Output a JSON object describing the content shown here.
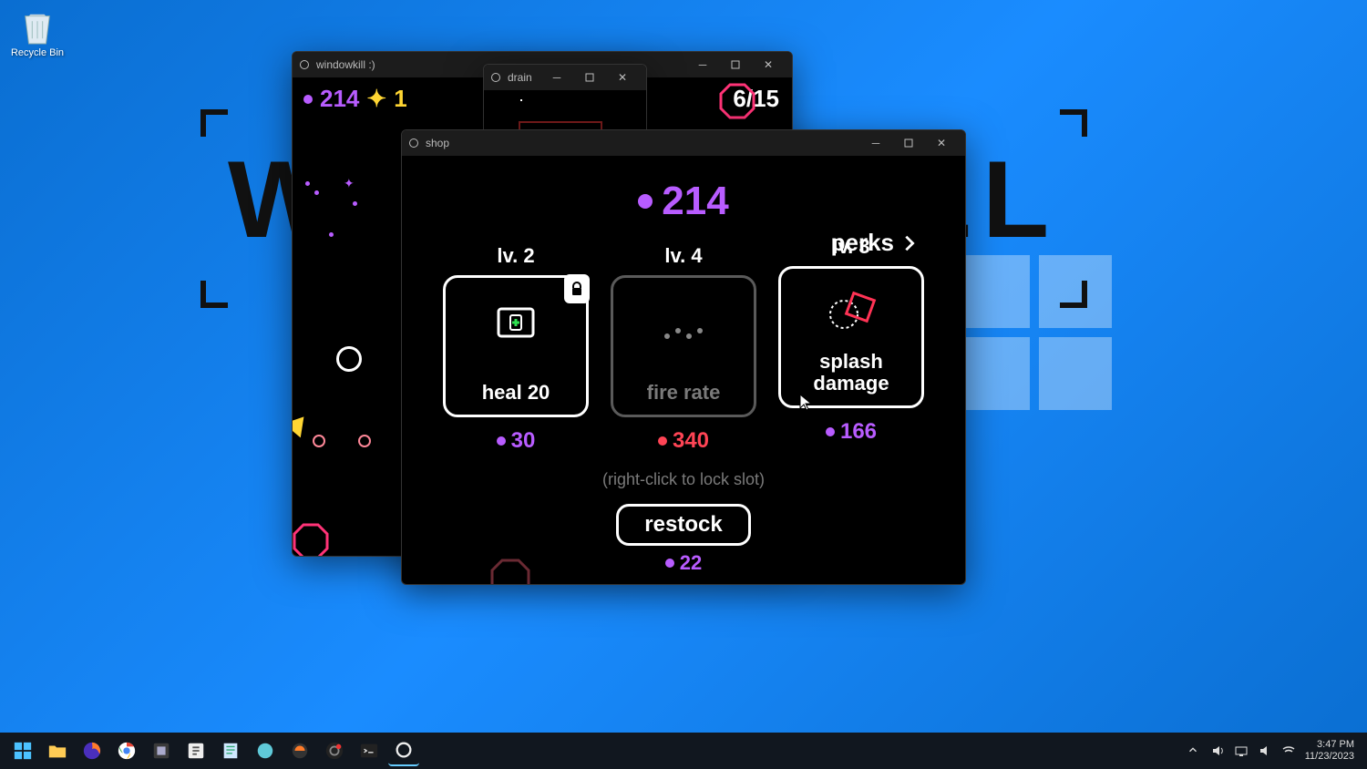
{
  "desktop": {
    "recycle_bin": "Recycle Bin"
  },
  "wallpaper_text": "WINDOWKILL",
  "windows": {
    "game": {
      "title": "windowkill :)",
      "currency": "214",
      "diamonds": "1",
      "progress": "6/15"
    },
    "drain": {
      "title": "drain"
    },
    "shop": {
      "title": "shop",
      "currency": "214",
      "perks_label": "perks",
      "hint": "(right-click to lock slot)",
      "restock_label": "restock",
      "restock_price": "22",
      "slots": [
        {
          "level": "lv. 2",
          "name": "heal 20",
          "price": "30",
          "locked": true,
          "affordable": true
        },
        {
          "level": "lv. 4",
          "name": "fire rate",
          "price": "340",
          "locked": false,
          "affordable": false
        },
        {
          "level": "lv. 3",
          "name": "splash\ndamage",
          "price": "166",
          "locked": false,
          "affordable": true
        }
      ]
    }
  },
  "taskbar": {
    "time": "3:47 PM",
    "date": "11/23/2023"
  }
}
